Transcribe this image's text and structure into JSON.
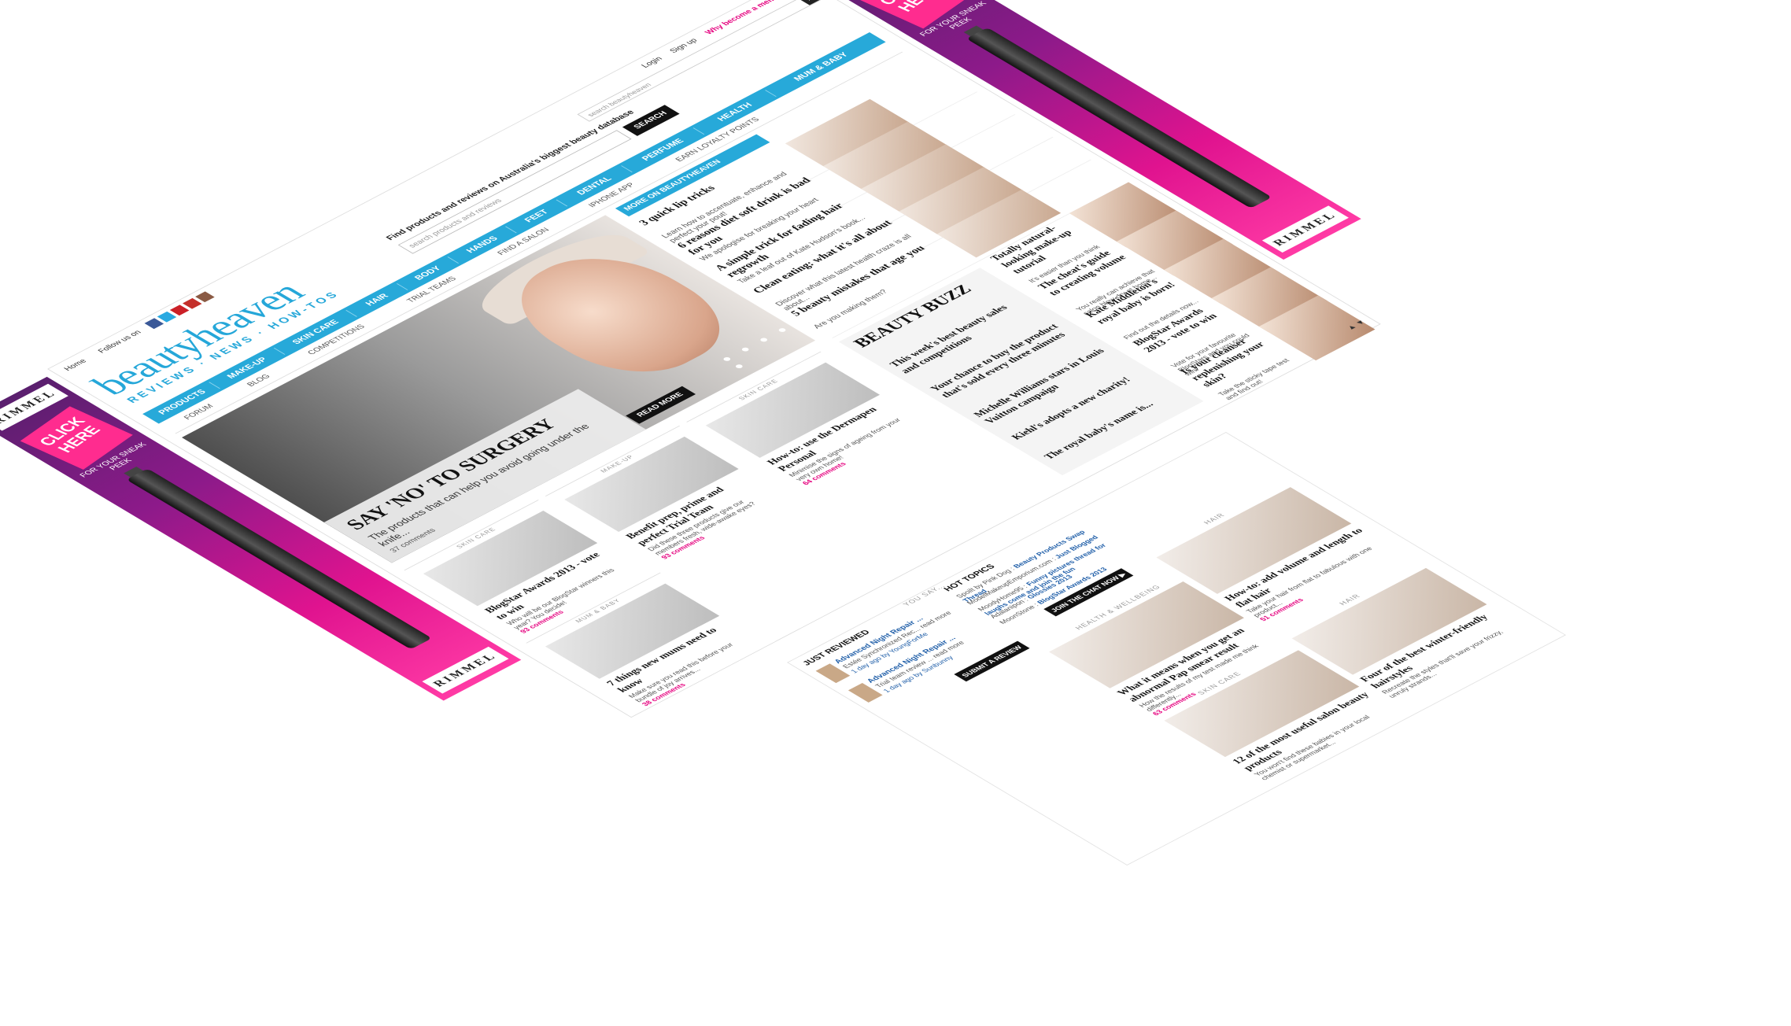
{
  "ad": {
    "brand": "RIMMEL",
    "cta": "CLICK HERE",
    "cta_sub": "FOR YOUR SNEAK PEEK",
    "colors": {
      "purple": "#5a1f6e",
      "pink": "#e0138f"
    }
  },
  "topbar": {
    "home": "Home",
    "follow": "Follow us on",
    "social_icons": [
      "facebook-icon",
      "twitter-icon",
      "pinterest-icon",
      "youtube-icon",
      "instagram-icon"
    ],
    "login": "Login",
    "signup": "Sign up",
    "why": "Why become a member?",
    "site_search_placeholder": "search beautyheaven"
  },
  "logo": {
    "main": "beautyheaven",
    "tagline": "REVIEWS · NEWS · HOW-TOS"
  },
  "finder": {
    "title": "Find products and reviews on Australia's biggest beauty database",
    "placeholder": "search products and reviews",
    "button": "SEARCH"
  },
  "nav": [
    "PRODUCTS",
    "MAKE-UP",
    "SKIN CARE",
    "HAIR",
    "BODY",
    "HANDS",
    "FEET",
    "DENTAL",
    "PERFUME",
    "HEALTH",
    "MUM & BABY"
  ],
  "subnav": [
    "FORUM",
    "BLOG",
    "COMPETITIONS",
    "TRIAL TEAMS",
    "FIND A SALON",
    "IPHONE APP",
    "EARN LOYALTY POINTS"
  ],
  "hero": {
    "title": "SAY 'NO' TO SURGERY",
    "text": "The products that can help you avoid going under the knife...",
    "read_more": "READ MORE",
    "comments": "37 comments"
  },
  "more": {
    "label": "MORE ON BEAUTYHEAVEN"
  },
  "side_items": [
    {
      "title": "3 quick lip tricks",
      "text": "Learn how to accentuate, enhance and perfect your pout!"
    },
    {
      "title": "6 reasons diet soft drink is bad for you",
      "text": "We apologise for breaking your heart"
    },
    {
      "title": "A simple trick for fading hair regrowth",
      "text": "Take a leaf out of Kate Hudson's book..."
    },
    {
      "title": "Clean eating: what it's all about",
      "text": "Discover what this latest health craze is all about..."
    },
    {
      "title": "5 beauty mistakes that age you",
      "text": "Are you making them?"
    }
  ],
  "cards": [
    {
      "tag": "SKIN CARE",
      "title": "BlogStar Awards 2013 - vote to win",
      "text": "Who will be our BlogStar winners this year? You decide!",
      "count": "93 comments"
    },
    {
      "tag": "MAKE-UP",
      "title": "Benefit prep, prime and perfect Trial Team",
      "text": "Did these three products give our members fresh, wide-awake eyes?",
      "count": "93 comments"
    },
    {
      "tag": "MUM & BABY",
      "title": "7 things new mums need to know",
      "text": "Make sure you read this before your bundle of joy arrives...",
      "count": "38 comments"
    },
    {
      "tag": "SKIN CARE",
      "title": "How-to: use the Dermapen Personal",
      "text": "Minimise the signs of ageing from your very own home!",
      "count": "64 comments"
    }
  ],
  "buzz": {
    "head": "BEAUTY BUZZ",
    "items": [
      "This week's best beauty sales and competitions",
      "Your chance to buy the product that's sold every three minutes",
      "Michelle Williams stars in Louis Vuitton campaign",
      "Kiehl's adopts a new charity!",
      "The royal baby's name is..."
    ]
  },
  "rcol": [
    {
      "title": "Totally natural-looking make-up tutorial",
      "text": "It's easier than you think"
    },
    {
      "title": "The cheat's guide to creating volume",
      "text": "You really can achieve that salon blow-dry at home..."
    },
    {
      "title": "Kate Middleton's royal baby is born!",
      "text": "Find out the details now..."
    },
    {
      "title": "BlogStar Awards 2013 - vote to win",
      "text": "Vote for your favourite BlogStars and you could win!"
    },
    {
      "title": "Is your cleanser replenishing your skin?",
      "text": "Take the sticky tape test and find out!"
    }
  ],
  "scroll": "▲ ▼",
  "lower": {
    "you_say": "YOU SAY...",
    "just_reviewed": "JUST REVIEWED",
    "reviews": [
      {
        "name": "Advanced Night Repair ...",
        "sub": "Estée Synchronized Rec... read more",
        "by": "1 day ago by YoungForMe"
      },
      {
        "name": "Advanced Night Repair ...",
        "sub": "Trial team review ... read more",
        "by": "1 day ago by Sunbunny"
      }
    ],
    "submit": "SUBMIT A REVIEW ▶",
    "hot_topics": "HOT TOPICS",
    "topics": [
      {
        "who": "Spoilt by Pink Dog",
        "what": "Beauty Products Swap Thread"
      },
      {
        "who": "ModelMakeupEmporium.com",
        "what": "Just Blogged"
      },
      {
        "who": "MoodyHome95",
        "what": "Funny pictures thread for laughs come and join the fun"
      },
      {
        "who": "Adalanipon",
        "what": "Glossies 2013"
      },
      {
        "who": "MoonStone",
        "what": "BlogStar Awards 2013"
      }
    ],
    "join_chat": "JOIN THE CHAT NOW ▶",
    "cards": [
      {
        "tag": "HAIR",
        "title": "How-to: add volume and length to flat hair",
        "text": "Take your hair from flat to fabulous with one product...",
        "count": "51 comments"
      },
      {
        "tag": "HEALTH & WELLBEING",
        "title": "What it means when you get an abnormal Pap smear result",
        "text": "How the results of my test made me think differently...",
        "count": "63 comments"
      },
      {
        "tag": "HAIR",
        "title": "Four of the best winter-friendly hairstyles",
        "text": "Recreate the styles that'll save your frizzy, unruly strands...",
        "count": ""
      },
      {
        "tag": "SKIN CARE",
        "title": "12 of the most useful salon beauty products",
        "text": "You won't find these babies in your local chemist or supermarket...",
        "count": ""
      }
    ]
  }
}
